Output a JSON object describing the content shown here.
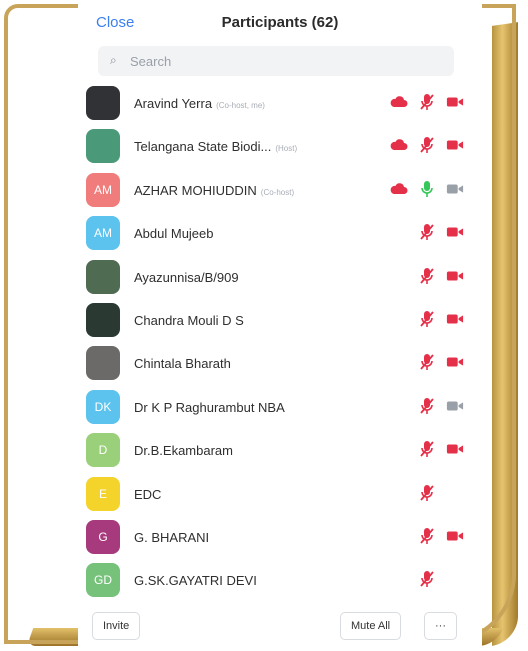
{
  "header": {
    "close_label": "Close",
    "title": "Participants (62)"
  },
  "search": {
    "placeholder": "Search"
  },
  "participants": [
    {
      "name": "Aravind Yerra",
      "role": "(Co-host, me)",
      "avatar_color": "#303235",
      "avatar_text": "",
      "cloud": true,
      "mic": "muted",
      "video": "off"
    },
    {
      "name": "Telangana State Biodi...",
      "role": "(Host)",
      "avatar_color": "#4a9a7a",
      "avatar_text": "",
      "cloud": true,
      "mic": "muted",
      "video": "off"
    },
    {
      "name": "AZHAR MOHIUDDIN",
      "role": "(Co-host)",
      "avatar_color": "#f07c7c",
      "avatar_text": "AM",
      "cloud": true,
      "mic": "on",
      "video": "gray"
    },
    {
      "name": "Abdul Mujeeb",
      "role": "",
      "avatar_color": "#5cc2ee",
      "avatar_text": "AM",
      "cloud": false,
      "mic": "muted",
      "video": "off"
    },
    {
      "name": "Ayazunnisa/B/909",
      "role": "",
      "avatar_color": "#4f6b52",
      "avatar_text": "",
      "cloud": false,
      "mic": "muted",
      "video": "off"
    },
    {
      "name": "Chandra Mouli D S",
      "role": "",
      "avatar_color": "#2a3a32",
      "avatar_text": "",
      "cloud": false,
      "mic": "muted",
      "video": "off"
    },
    {
      "name": "Chintala Bharath",
      "role": "",
      "avatar_color": "#6b6a68",
      "avatar_text": "",
      "cloud": false,
      "mic": "muted",
      "video": "off"
    },
    {
      "name": "Dr K P Raghurambut NBA",
      "role": "",
      "avatar_color": "#5cc2ee",
      "avatar_text": "DK",
      "cloud": false,
      "mic": "muted",
      "video": "gray"
    },
    {
      "name": "Dr.B.Ekambaram",
      "role": "",
      "avatar_color": "#9ad07a",
      "avatar_text": "D",
      "cloud": false,
      "mic": "muted",
      "video": "off"
    },
    {
      "name": "EDC",
      "role": "",
      "avatar_color": "#f4d32a",
      "avatar_text": "E",
      "cloud": false,
      "mic": "muted",
      "video": "none"
    },
    {
      "name": "G. BHARANI",
      "role": "",
      "avatar_color": "#a63a7c",
      "avatar_text": "G",
      "cloud": false,
      "mic": "muted",
      "video": "off"
    },
    {
      "name": "G.SK.GAYATRI DEVI",
      "role": "",
      "avatar_color": "#76c27a",
      "avatar_text": "GD",
      "cloud": false,
      "mic": "muted",
      "video": "none"
    }
  ],
  "footer": {
    "invite_label": "Invite",
    "mute_all_label": "Mute All",
    "more_label": "···"
  },
  "colors": {
    "accent": "#3b7ff0",
    "muted_red": "#e5304a",
    "mic_green": "#35c759",
    "gray": "#9aa0a8"
  }
}
